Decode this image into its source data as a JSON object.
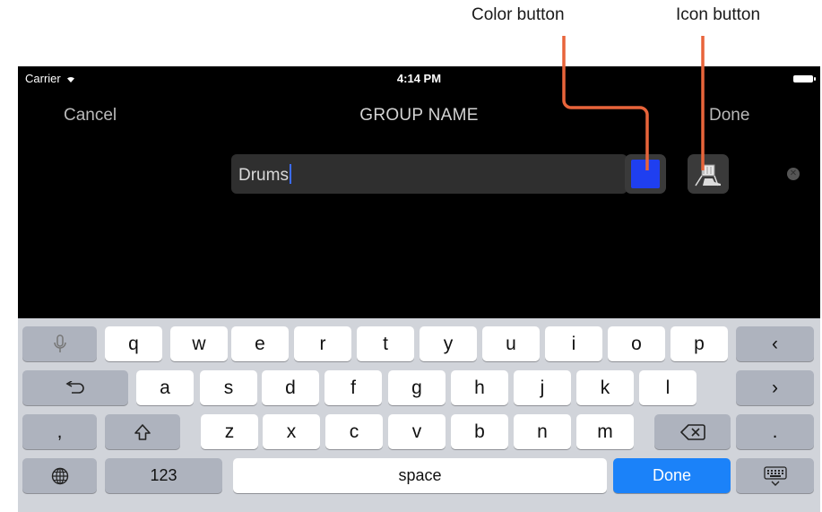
{
  "annotations": {
    "color_button_label": "Color button",
    "icon_button_label": "Icon button"
  },
  "status_bar": {
    "carrier": "Carrier",
    "time": "4:14 PM"
  },
  "nav": {
    "cancel": "Cancel",
    "title": "GROUP NAME",
    "done": "Done"
  },
  "name_field": {
    "value": "Drums"
  },
  "color_button": {
    "color": "#1f3ff0"
  },
  "keyboard": {
    "row1": [
      "q",
      "w",
      "e",
      "r",
      "t",
      "y",
      "u",
      "i",
      "o",
      "p"
    ],
    "row2": [
      "a",
      "s",
      "d",
      "f",
      "g",
      "h",
      "j",
      "k",
      "l"
    ],
    "row3": [
      "z",
      "x",
      "c",
      "v",
      "b",
      "n",
      "m"
    ],
    "comma": ",",
    "period": ".",
    "numbers": "123",
    "space": "space",
    "done": "Done",
    "icons": [
      "microphone-icon",
      "backspace-icon",
      "undo-icon",
      "shift-icon",
      "delete-icon",
      "globe-icon",
      "keyboard-dismiss-icon",
      "chevron-left-icon",
      "chevron-right-icon"
    ]
  }
}
